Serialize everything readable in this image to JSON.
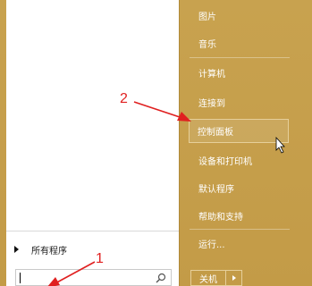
{
  "start_menu": {
    "all_programs_label": "所有程序",
    "search": {
      "value": "",
      "placeholder": ""
    },
    "right_items": [
      "图片",
      "音乐",
      "计算机",
      "连接到",
      "控制面板",
      "设备和打印机",
      "默认程序",
      "帮助和支持",
      "运行..."
    ],
    "hovered_item": "控制面板",
    "shutdown_label": "关机"
  },
  "annotations": {
    "step1": "1",
    "step2": "2"
  },
  "colors": {
    "background": "#c6a04f",
    "annotation": "#e02020",
    "menu_text": "#ffffff"
  },
  "icons": [
    "triangle-right-icon",
    "search-icon",
    "chevron-right-icon",
    "mouse-cursor-icon"
  ]
}
